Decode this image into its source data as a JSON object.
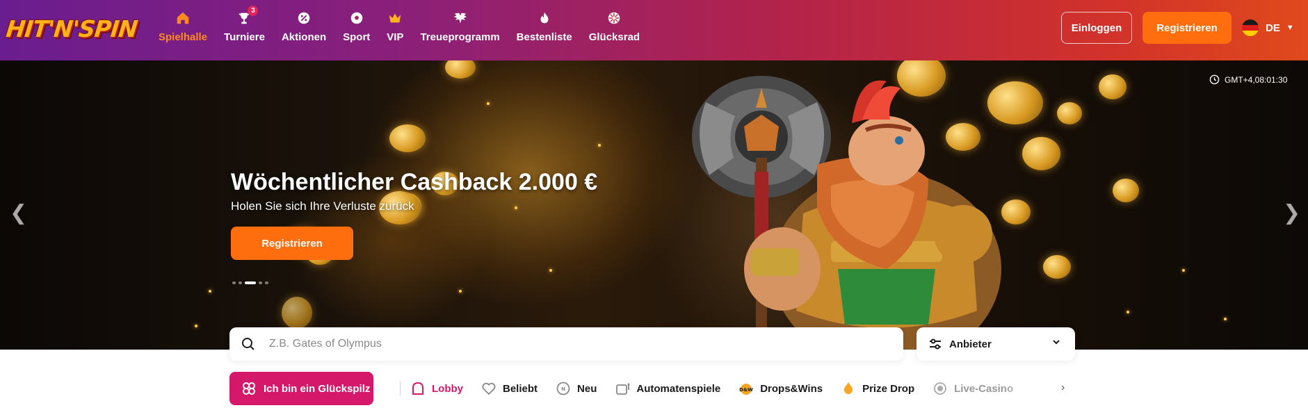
{
  "brand": {
    "logo_text": "HIT'N'SPIN"
  },
  "nav": {
    "items": [
      {
        "label": "Spielhalle",
        "icon": "home-icon",
        "active": true
      },
      {
        "label": "Turniere",
        "icon": "trophy-icon",
        "badge": "3"
      },
      {
        "label": "Aktionen",
        "icon": "discount-icon"
      },
      {
        "label": "Sport",
        "icon": "football-icon"
      },
      {
        "label": "VIP",
        "icon": "crown-icon"
      },
      {
        "label": "Treueprogramm",
        "icon": "wings-icon"
      },
      {
        "label": "Bestenliste",
        "icon": "fire-icon"
      },
      {
        "label": "Glücksrad",
        "icon": "wheel-icon"
      }
    ]
  },
  "auth": {
    "login_label": "Einloggen",
    "register_label": "Registrieren"
  },
  "language": {
    "code": "DE",
    "flag_icon": "germany-flag-icon"
  },
  "hero": {
    "timezone": "GMT+4,08:01:30",
    "title": "Wöchentlicher Cashback 2.000 €",
    "subtitle": "Holen Sie sich Ihre Verluste zurück",
    "cta_label": "Registrieren",
    "slide_count": 5,
    "active_slide": 3
  },
  "search": {
    "placeholder": "Z.B. Gates of Olympus",
    "value": ""
  },
  "provider_filter": {
    "label": "Anbieter"
  },
  "lucky_button": {
    "label": "Ich bin ein Glückspilz"
  },
  "categories": [
    {
      "label": "Lobby",
      "icon": "lobby-icon",
      "active": true
    },
    {
      "label": "Beliebt",
      "icon": "heart-icon"
    },
    {
      "label": "Neu",
      "icon": "new-icon"
    },
    {
      "label": "Automatenspiele",
      "icon": "slot-machine-icon"
    },
    {
      "label": "Drops&Wins",
      "icon": "drops-wins-icon"
    },
    {
      "label": "Prize Drop",
      "icon": "prize-drop-icon"
    },
    {
      "label": "Live-Casino",
      "icon": "live-casino-icon",
      "faded": true
    }
  ],
  "colors": {
    "accent_orange": "#ff6e0e",
    "accent_pink": "#d6186b",
    "header_start": "#6a1d8f",
    "header_end": "#e04a1c"
  }
}
